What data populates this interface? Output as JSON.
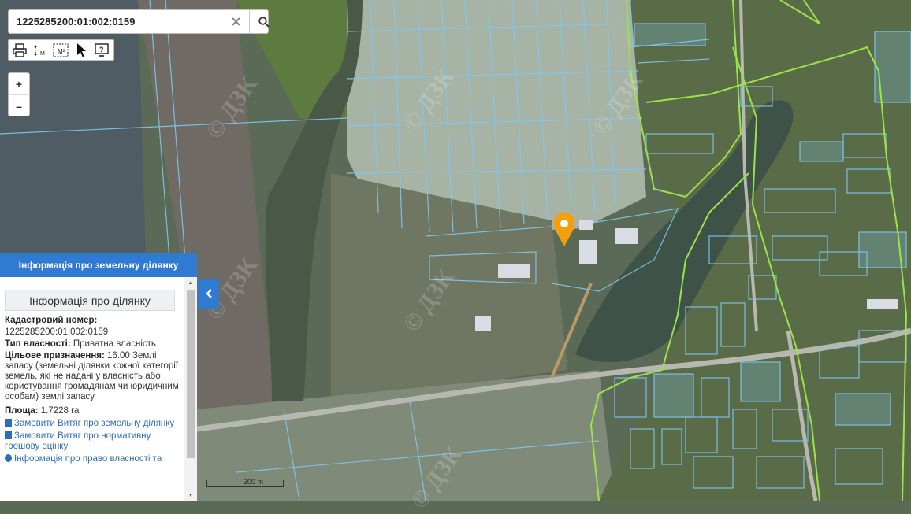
{
  "search": {
    "value": "1225285200:01:002:0159"
  },
  "toolbar": {
    "tools": [
      "print-icon",
      "measure-length-icon",
      "measure-area-icon",
      "pointer-icon",
      "help-icon"
    ]
  },
  "zoom": {
    "in_label": "+",
    "out_label": "–"
  },
  "watermark": "© ДЗК",
  "panel": {
    "header": "Інформація про земельну ділянку",
    "title": "Інформація про ділянку",
    "cadastral_label": "Кадастровий номер:",
    "cadastral_value": "1225285200:01:002:0159",
    "ownership_label": "Тип власності:",
    "ownership_value": "Приватна власність",
    "purpose_label": "Цільове призначення:",
    "purpose_value": "16.00 Землі запасу (земельні ділянки кожної категорії земель, які не надані у власність або користування громадянам чи юридичним особам) землі запасу",
    "area_label": "Площа:",
    "area_value": "1.7228 га",
    "links": [
      "Замовити Витяг про земельну ділянку",
      "Замовити Витяг про нормативну грошову оцінку",
      "Інформація про право власності та"
    ]
  },
  "scale_label": "200 m",
  "colors": {
    "panel_blue": "#2f7bd1",
    "parcel_outline": "#7fc8f0",
    "boundary": "#9be34a",
    "marker": "#f2a10c"
  }
}
